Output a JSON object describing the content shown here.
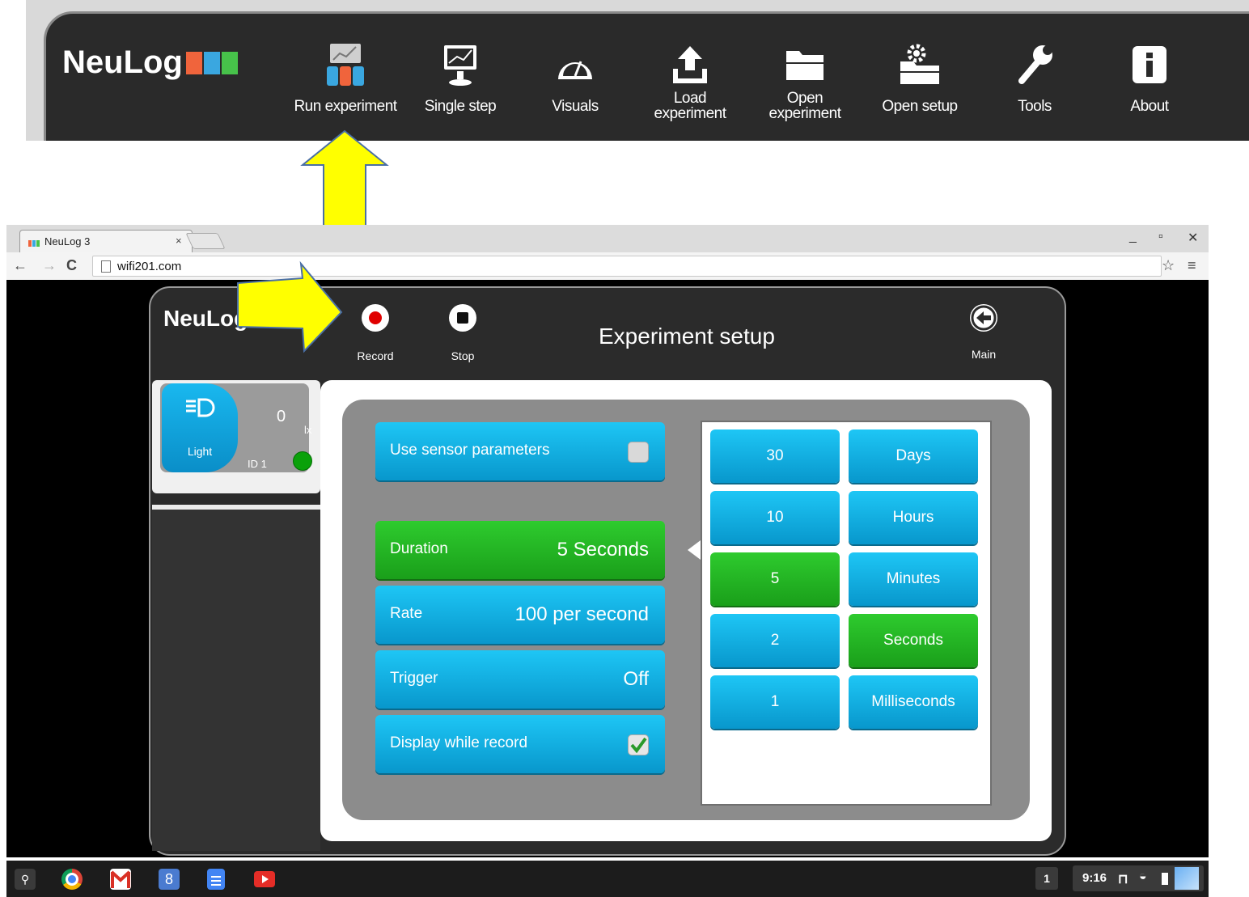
{
  "top_toolbar": {
    "logo_text": "NeuLog",
    "items": [
      {
        "label": "Run experiment",
        "icon": "run-experiment-icon"
      },
      {
        "label": "Single step",
        "icon": "single-step-icon"
      },
      {
        "label": "Visuals",
        "icon": "gauge-icon"
      },
      {
        "label": "Load\nexperiment",
        "icon": "upload-icon"
      },
      {
        "label": "Open\nexperiment",
        "icon": "folder-icon"
      },
      {
        "label": "Open setup",
        "icon": "gear-folder-icon"
      },
      {
        "label": "Tools",
        "icon": "wrench-icon"
      },
      {
        "label": "About",
        "icon": "info-icon"
      }
    ]
  },
  "browser": {
    "tab_title": "NeuLog 3",
    "tab_close": "×",
    "url": "wifi201.com",
    "window_controls": {
      "minimize": "_",
      "restore": "▫",
      "close": "✕"
    }
  },
  "app": {
    "logo_text": "NeuLog",
    "header": {
      "record_label": "Record",
      "stop_label": "Stop",
      "title": "Experiment setup",
      "main_label": "Main"
    },
    "sensor": {
      "name": "Light",
      "value": "0",
      "unit": "lx",
      "id": "ID 1",
      "led_color": "#0aa10a"
    },
    "settings": {
      "use_sensor_params": {
        "label": "Use sensor parameters",
        "checked": false
      },
      "duration": {
        "label": "Duration",
        "value": "5 Seconds",
        "selected": true
      },
      "rate": {
        "label": "Rate",
        "value": "100 per second"
      },
      "trigger": {
        "label": "Trigger",
        "value": "Off"
      },
      "display_while_record": {
        "label": "Display while record",
        "checked": true
      }
    },
    "picker": {
      "numbers": [
        {
          "label": "30",
          "selected": false
        },
        {
          "label": "10",
          "selected": false
        },
        {
          "label": "5",
          "selected": true
        },
        {
          "label": "2",
          "selected": false
        },
        {
          "label": "1",
          "selected": false
        }
      ],
      "units": [
        {
          "label": "Days",
          "selected": false
        },
        {
          "label": "Hours",
          "selected": false
        },
        {
          "label": "Minutes",
          "selected": false
        },
        {
          "label": "Seconds",
          "selected": true
        },
        {
          "label": "Milliseconds",
          "selected": false
        }
      ]
    }
  },
  "taskbar": {
    "apps": [
      "search-icon",
      "chrome-icon",
      "gmail-icon",
      "google-plus-icon",
      "docs-icon",
      "youtube-icon"
    ],
    "notification_count": "1",
    "clock": "9:16"
  },
  "colors": {
    "accent_blue": "#0fb0e8",
    "selected_green": "#22b422",
    "arrow_yellow": "#ffff00"
  }
}
